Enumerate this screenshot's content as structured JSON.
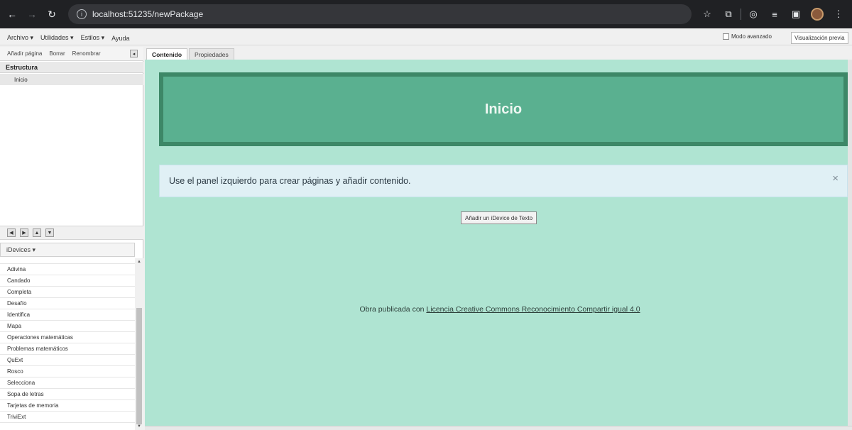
{
  "browser": {
    "url": "localhost:51235/newPackage",
    "star_icon": "star-icon",
    "extensions_icon": "puzzle-icon"
  },
  "menubar": {
    "items": [
      "Archivo ▾",
      "Utilidades ▾",
      "Estilos ▾",
      "Ayuda"
    ],
    "advanced_mode_label": "Modo avanzado",
    "preview_button": "Visualización previa"
  },
  "left": {
    "toolbar": [
      "Añadir página",
      "Borrar",
      "Renombrar"
    ],
    "structure_header": "Estructura",
    "tree_items": [
      "Inicio"
    ],
    "idevices_header": "iDevices ▾",
    "idevices": [
      "Adivina",
      "Candado",
      "Completa",
      "Desafío",
      "Identifica",
      "Mapa",
      "Operaciones matemáticas",
      "Problemas matemáticos",
      "QuExt",
      "Rosco",
      "Selecciona",
      "Sopa de letras",
      "Tarjetas de memoria",
      "TriviExt"
    ]
  },
  "tabs": [
    "Contenido",
    "Propiedades"
  ],
  "content": {
    "page_title": "Inicio",
    "alert": "Use el panel izquierdo para crear páginas y añadir contenido.",
    "add_button": "Añadir un iDevice de Texto",
    "footer_prefix": "Obra publicada con ",
    "footer_link": "Licencia Creative Commons Reconocimiento Compartir igual 4.0"
  },
  "colors": {
    "content_bg": "#afe4d2",
    "title_bg": "#5ab090",
    "title_border": "#3d8767",
    "alert_bg": "#e0f0f5"
  }
}
